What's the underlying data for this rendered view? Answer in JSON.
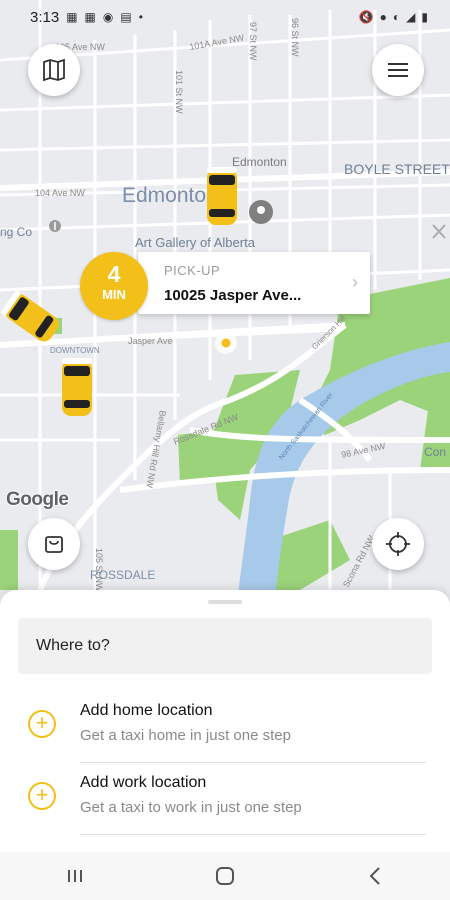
{
  "status_bar": {
    "time": "3:13",
    "left_icons": [
      "message-icon",
      "message-icon",
      "mask-icon",
      "image-icon",
      "dot-icon"
    ],
    "right_icons": [
      "mute-icon",
      "location-icon",
      "wifi-icon",
      "signal-icon",
      "battery-icon"
    ]
  },
  "map": {
    "labels": {
      "edmonton_city": "Edmonton",
      "edmonton_small": "Edmonton",
      "boyle_street": "BOYLE STREET",
      "art_gallery": "Art Gallery of Alberta",
      "ng_co": "ng Co",
      "downtown": "DOWNTOWN",
      "rossdale": "ROSSDALE",
      "con": "Con",
      "ave_104": "104 Ave NW",
      "ave_105": "105 Ave NW",
      "ave_101a": "101A Ave NW",
      "ave_98": "98 Ave NW",
      "jasper_ave": "Jasper Ave",
      "st_97": "97 St NW",
      "st_96": "96 St NW",
      "st_101": "101 St NW",
      "bellamy_hill": "Bellamy Hill Rd NW",
      "rossdale_rd": "Rossdale Rd NW",
      "grierson_hill": "Grierson Hill",
      "river": "North Saskatchewan River",
      "scona_rd": "Scona Rd NW",
      "st_105": "105 St NW"
    },
    "google_logo": "Google"
  },
  "eta": {
    "minutes": "4",
    "unit": "MIN"
  },
  "pickup": {
    "label": "PICK-UP",
    "address": "10025 Jasper Ave..."
  },
  "sheet": {
    "search_placeholder": "Where to?",
    "items": [
      {
        "title": "Add home location",
        "subtitle": "Get a taxi home in just one step"
      },
      {
        "title": "Add work location",
        "subtitle": "Get a taxi to work in just one step"
      }
    ]
  },
  "colors": {
    "accent": "#f2c018",
    "park": "#9bd37a",
    "river": "#a7c9ea",
    "map_bg": "#e9ebee"
  }
}
